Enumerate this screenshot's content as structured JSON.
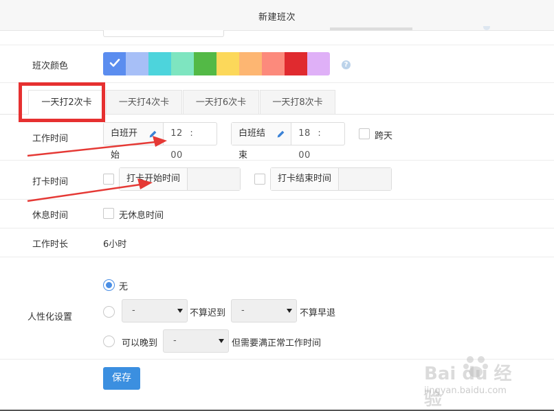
{
  "header": {
    "title": "新建班次"
  },
  "labels": {
    "shift_color": "班次颜色",
    "work_time": "工作时间",
    "punch_time": "打卡时间",
    "rest_time": "休息时间",
    "work_duration": "工作时长",
    "humanize": "人性化设置"
  },
  "palette": {
    "colors": [
      "#5b8def",
      "#a7bff7",
      "#4dd4dc",
      "#7ee5c0",
      "#53b946",
      "#fcd85a",
      "#fdb672",
      "#fc8a7c",
      "#e02a2f",
      "#dfb0f7"
    ],
    "selected_index": 0
  },
  "tabs": [
    {
      "label": "一天打2次卡",
      "active": true
    },
    {
      "label": "一天打4次卡",
      "active": false
    },
    {
      "label": "一天打6次卡",
      "active": false
    },
    {
      "label": "一天打8次卡",
      "active": false
    }
  ],
  "work_time": {
    "start_label": "白班开始",
    "start_hour": "12",
    "start_min": "00",
    "end_label": "白班结束",
    "end_hour": "18",
    "end_min": "00",
    "time_sep": ":",
    "cross_day_label": "跨天"
  },
  "punch_time": {
    "start_label": "打卡开始时间",
    "end_label": "打卡结束时间"
  },
  "rest_time": {
    "none_label": "无休息时间"
  },
  "work_duration": {
    "value": "6小时"
  },
  "humanize": {
    "option_none": "无",
    "select_dash": "-",
    "not_late_label": "不算迟到",
    "not_early_label": "不算早退",
    "can_late_label": "可以晚到",
    "need_full_label": "但需要满正常工作时间"
  },
  "actions": {
    "save_label": "保存"
  },
  "watermark": {
    "brand": "Bai du 经验",
    "url": "jingyan.baidu.com"
  }
}
